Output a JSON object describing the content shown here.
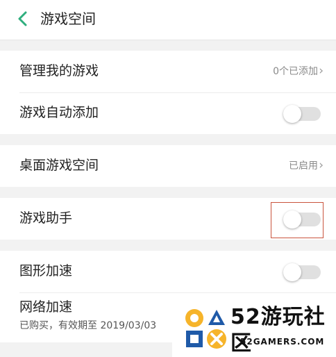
{
  "header": {
    "title": "游戏空间"
  },
  "groups": {
    "group1": {
      "manage": {
        "label": "管理我的游戏",
        "value": "0个已添加"
      },
      "auto_add": {
        "label": "游戏自动添加",
        "toggle": false
      }
    },
    "group2": {
      "desktop": {
        "label": "桌面游戏空间",
        "value": "已启用"
      }
    },
    "group3": {
      "assistant": {
        "label": "游戏助手",
        "toggle": false
      }
    },
    "group4": {
      "graphics": {
        "label": "图形加速",
        "toggle": false
      },
      "network": {
        "label": "网络加速",
        "sublabel": "已购买，有效期至 2019/03/03"
      }
    }
  },
  "chevron_glyph": "›",
  "watermark": {
    "title": "52游玩社区",
    "subtitle": "52GAMERS.COM"
  },
  "colors": {
    "accent_green": "#2fae7e",
    "toggle_off": "#e0e0e0",
    "highlight_box": "#c9533c",
    "logo_yellow": "#f6b42a",
    "logo_blue": "#1f5aa8"
  },
  "icons": [
    "back-chevron-icon",
    "chevron-right-icon",
    "gamepad-logo-icon"
  ]
}
